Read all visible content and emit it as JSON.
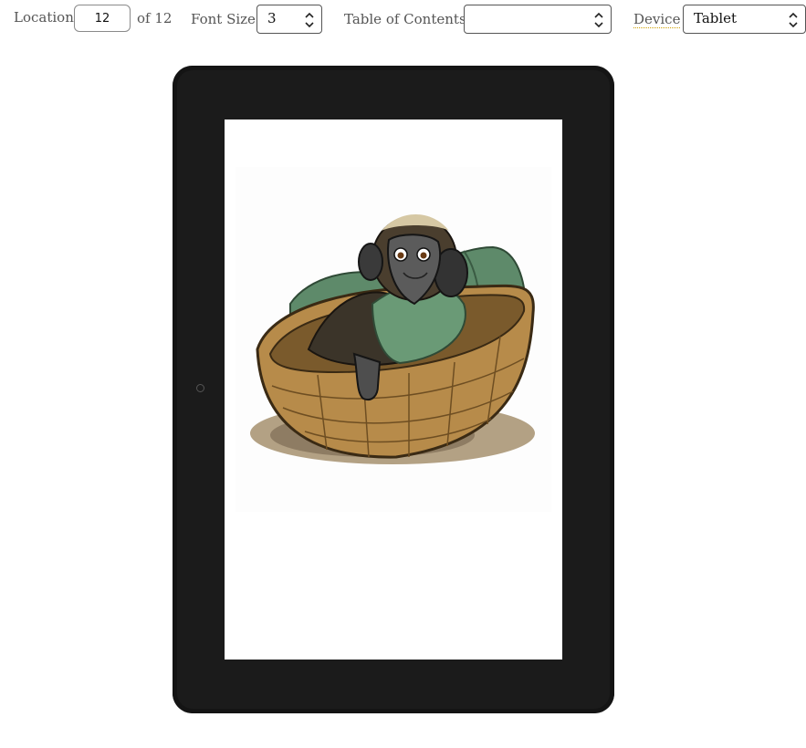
{
  "toolbar": {
    "location_label": "Location",
    "location_value": "12",
    "location_total": "of 12",
    "font_size_label": "Font Size",
    "font_size_value": "3",
    "toc_label": "Table of Contents",
    "toc_value": "",
    "device_label": "Device",
    "device_value": "Tablet"
  },
  "reader": {
    "page_image": "illustration of a gorilla-like ape lying in a woven basket under a green blanket"
  },
  "colors": {
    "bezel": "#1b1b1b",
    "screen": "#ffffff",
    "label_text": "#555555"
  }
}
